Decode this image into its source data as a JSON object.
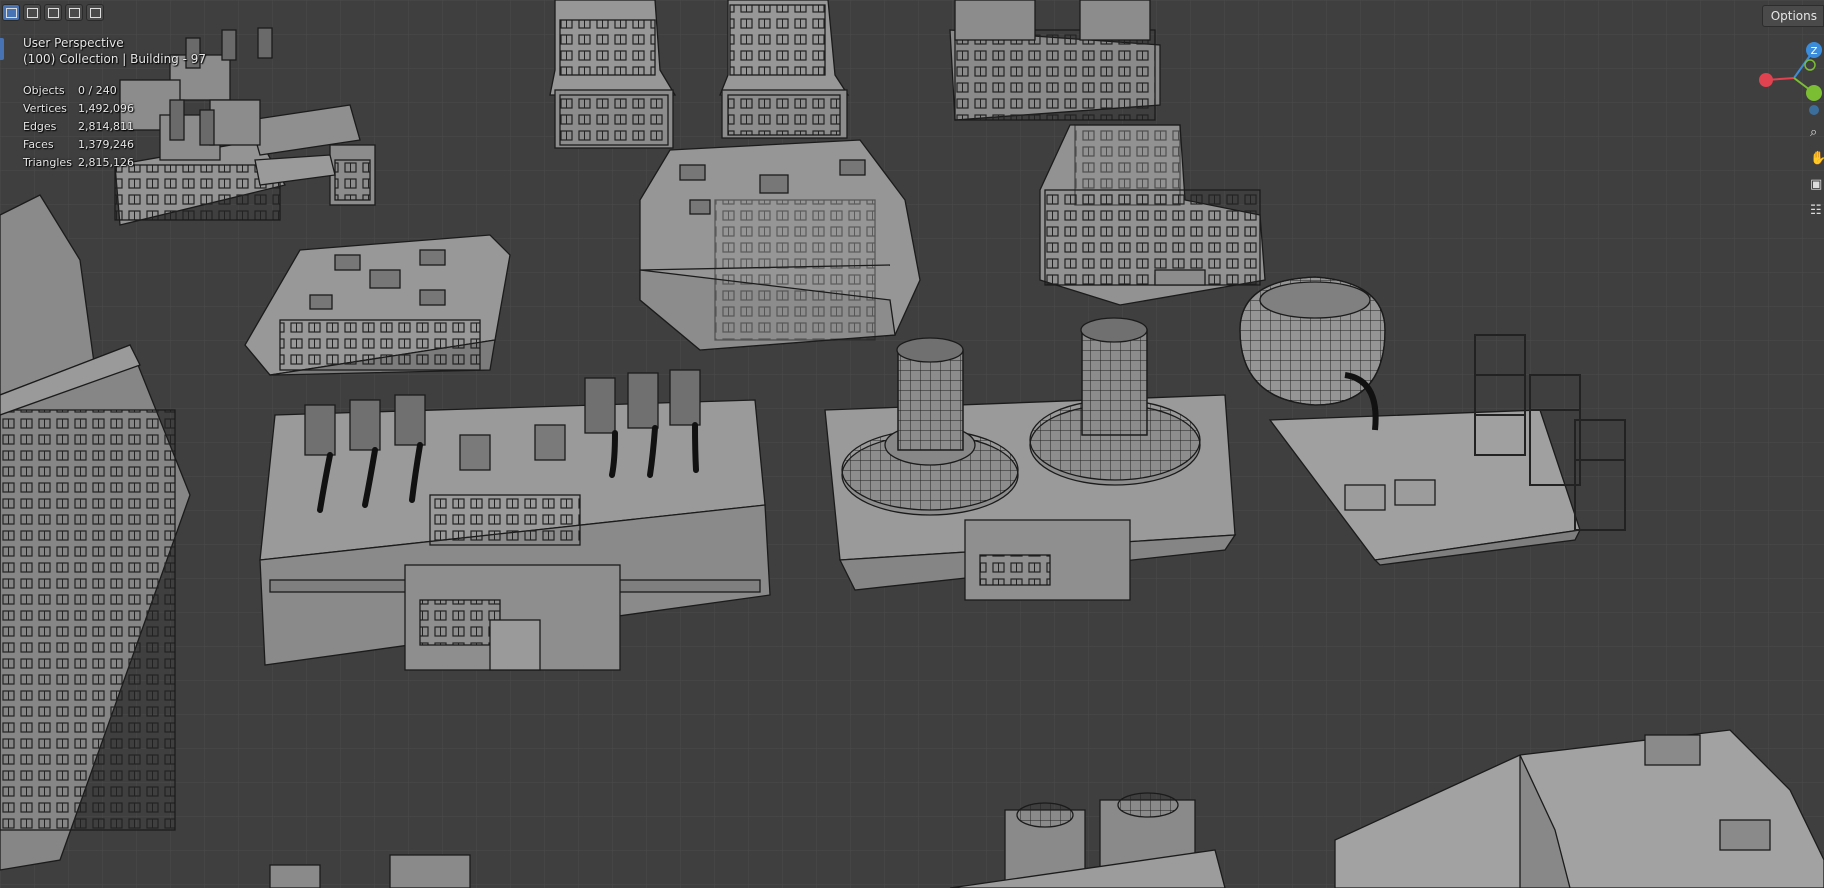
{
  "viewport_header": {
    "perspective": "User Perspective",
    "collection": "(100) Collection | Building - 97"
  },
  "stats": [
    {
      "label": "Objects",
      "value": "0 / 240"
    },
    {
      "label": "Vertices",
      "value": "1,492,096"
    },
    {
      "label": "Edges",
      "value": "2,814,811"
    },
    {
      "label": "Faces",
      "value": "1,379,246"
    },
    {
      "label": "Triangles",
      "value": "2,815,126"
    }
  ],
  "options_label": "Options",
  "gizmo": {
    "z_label": "Z",
    "x_color": "#e0424f",
    "y_color": "#7bbd33",
    "z_color": "#3b8ddb"
  },
  "select_modes": [
    "select-box-icon",
    "extend-select-icon",
    "subtract-select-icon",
    "invert-select-icon",
    "intersect-select-icon"
  ],
  "nav_tools": [
    "zoom-icon",
    "pan-hand-icon",
    "camera-icon",
    "grid-icon"
  ],
  "colors": {
    "background": "#3f3f3f",
    "grid_minor": "#474747",
    "grid_major": "#4f4f4f",
    "model_fill": "#8a8a8a",
    "model_edge": "#1a1a1a",
    "accent": "#4772b3"
  }
}
